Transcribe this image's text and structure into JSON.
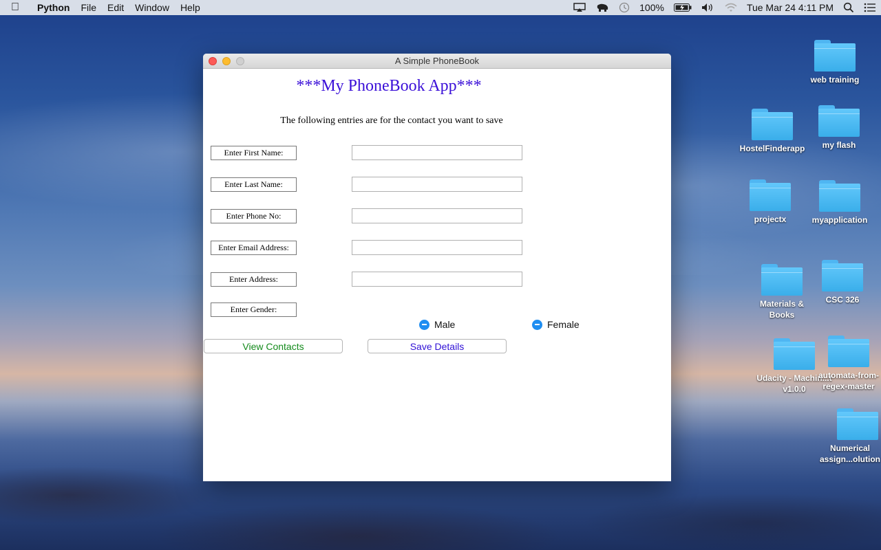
{
  "menubar": {
    "app": "Python",
    "menus": [
      "File",
      "Edit",
      "Window",
      "Help"
    ],
    "battery": "100%",
    "datetime": "Tue Mar 24  4:11 PM"
  },
  "window": {
    "title": "A Simple PhoneBook",
    "heading": "***My PhoneBook App***",
    "subtitle": "The following entries are for the contact you want to save",
    "fields": [
      {
        "label": "Enter First Name:",
        "value": ""
      },
      {
        "label": "Enter Last Name:",
        "value": ""
      },
      {
        "label": "Enter Phone No:",
        "value": ""
      },
      {
        "label": "Enter Email Address:",
        "value": ""
      },
      {
        "label": "Enter Address:",
        "value": ""
      }
    ],
    "gender_label": "Enter Gender:",
    "gender_options": [
      "Male",
      "Female"
    ],
    "buttons": {
      "view": "View Contacts",
      "save": "Save Details"
    },
    "colors": {
      "heading": "#3b10d8",
      "view_button": "#138a1b",
      "save_button": "#2f10d6"
    }
  },
  "desktop": {
    "icons": [
      "web training",
      "HostelFinderapp",
      "my flash",
      "projectx",
      "myapplication",
      "Materials & Books",
      "CSC 326",
      "Udacity - Machin...t v1.0.0",
      "automata-from-regex-master",
      "Numerical assign...olution"
    ]
  }
}
